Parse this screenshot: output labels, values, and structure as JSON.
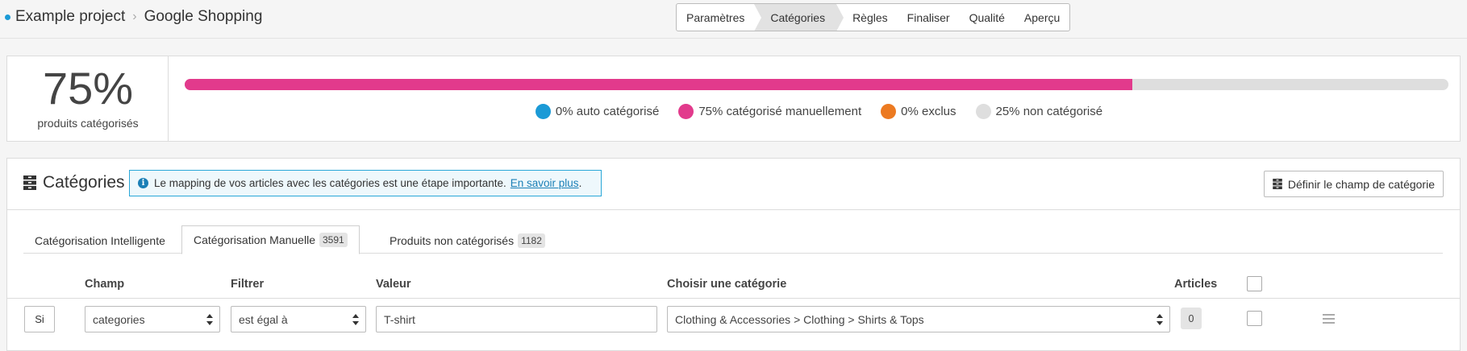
{
  "breadcrumb": {
    "project": "Example project",
    "page": "Google Shopping",
    "separator": "›"
  },
  "stepper": {
    "steps": [
      "Paramètres",
      "Catégories",
      "Règles",
      "Finaliser",
      "Qualité",
      "Aperçu"
    ],
    "active_index": 1
  },
  "progress": {
    "value_label": "75%",
    "caption": "produits catégorisés",
    "manual_fraction": 0.75,
    "legend": [
      {
        "label": "0% auto catégorisé",
        "color": "#1b9ad6"
      },
      {
        "label": "75% catégorisé manuellement",
        "color": "#e23a8c"
      },
      {
        "label": "0% exclus",
        "color": "#ec7a21"
      },
      {
        "label": "25% non catégorisé",
        "color": "#dedede"
      }
    ]
  },
  "categories": {
    "title": "Catégories",
    "info_text": "Le mapping de vos articles avec les catégories est une étape importante.",
    "info_link": "En savoir plus",
    "info_period": ".",
    "define_button": "Définir le champ de catégorie",
    "tabs": [
      {
        "label": "Catégorisation Intelligente",
        "badge": ""
      },
      {
        "label": "Catégorisation Manuelle",
        "badge": "3591"
      },
      {
        "label": "Produits non catégorisés",
        "badge": "1182"
      }
    ],
    "table": {
      "headers": {
        "champ": "Champ",
        "filtrer": "Filtrer",
        "valeur": "Valeur",
        "categorie": "Choisir une catégorie",
        "articles": "Articles"
      },
      "rows": [
        {
          "condition": "Si",
          "champ": "categories",
          "filtrer": "est égal à",
          "valeur": "T-shirt",
          "categorie": "Clothing & Accessories > Clothing > Shirts & Tops",
          "articles": "0"
        }
      ]
    }
  }
}
